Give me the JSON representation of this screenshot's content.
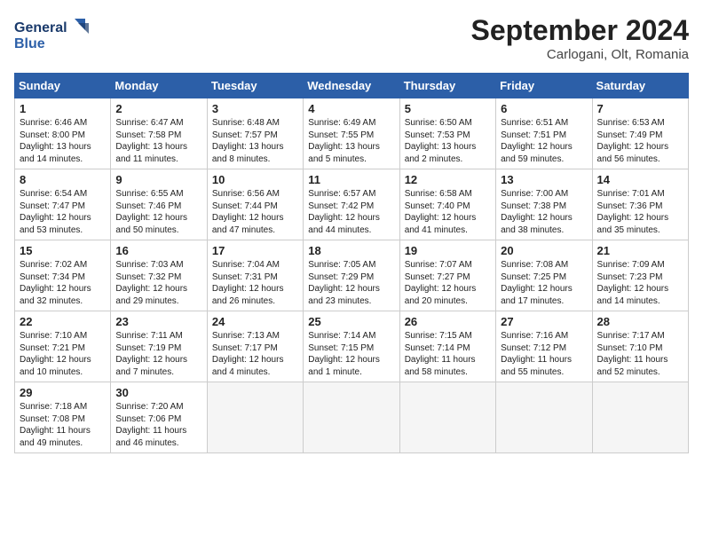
{
  "header": {
    "logo_line1": "General",
    "logo_line2": "Blue",
    "month": "September 2024",
    "location": "Carlogani, Olt, Romania"
  },
  "days_of_week": [
    "Sunday",
    "Monday",
    "Tuesday",
    "Wednesday",
    "Thursday",
    "Friday",
    "Saturday"
  ],
  "weeks": [
    [
      {
        "day": "1",
        "sunrise": "Sunrise: 6:46 AM",
        "sunset": "Sunset: 8:00 PM",
        "daylight": "Daylight: 13 hours and 14 minutes."
      },
      {
        "day": "2",
        "sunrise": "Sunrise: 6:47 AM",
        "sunset": "Sunset: 7:58 PM",
        "daylight": "Daylight: 13 hours and 11 minutes."
      },
      {
        "day": "3",
        "sunrise": "Sunrise: 6:48 AM",
        "sunset": "Sunset: 7:57 PM",
        "daylight": "Daylight: 13 hours and 8 minutes."
      },
      {
        "day": "4",
        "sunrise": "Sunrise: 6:49 AM",
        "sunset": "Sunset: 7:55 PM",
        "daylight": "Daylight: 13 hours and 5 minutes."
      },
      {
        "day": "5",
        "sunrise": "Sunrise: 6:50 AM",
        "sunset": "Sunset: 7:53 PM",
        "daylight": "Daylight: 13 hours and 2 minutes."
      },
      {
        "day": "6",
        "sunrise": "Sunrise: 6:51 AM",
        "sunset": "Sunset: 7:51 PM",
        "daylight": "Daylight: 12 hours and 59 minutes."
      },
      {
        "day": "7",
        "sunrise": "Sunrise: 6:53 AM",
        "sunset": "Sunset: 7:49 PM",
        "daylight": "Daylight: 12 hours and 56 minutes."
      }
    ],
    [
      {
        "day": "8",
        "sunrise": "Sunrise: 6:54 AM",
        "sunset": "Sunset: 7:47 PM",
        "daylight": "Daylight: 12 hours and 53 minutes."
      },
      {
        "day": "9",
        "sunrise": "Sunrise: 6:55 AM",
        "sunset": "Sunset: 7:46 PM",
        "daylight": "Daylight: 12 hours and 50 minutes."
      },
      {
        "day": "10",
        "sunrise": "Sunrise: 6:56 AM",
        "sunset": "Sunset: 7:44 PM",
        "daylight": "Daylight: 12 hours and 47 minutes."
      },
      {
        "day": "11",
        "sunrise": "Sunrise: 6:57 AM",
        "sunset": "Sunset: 7:42 PM",
        "daylight": "Daylight: 12 hours and 44 minutes."
      },
      {
        "day": "12",
        "sunrise": "Sunrise: 6:58 AM",
        "sunset": "Sunset: 7:40 PM",
        "daylight": "Daylight: 12 hours and 41 minutes."
      },
      {
        "day": "13",
        "sunrise": "Sunrise: 7:00 AM",
        "sunset": "Sunset: 7:38 PM",
        "daylight": "Daylight: 12 hours and 38 minutes."
      },
      {
        "day": "14",
        "sunrise": "Sunrise: 7:01 AM",
        "sunset": "Sunset: 7:36 PM",
        "daylight": "Daylight: 12 hours and 35 minutes."
      }
    ],
    [
      {
        "day": "15",
        "sunrise": "Sunrise: 7:02 AM",
        "sunset": "Sunset: 7:34 PM",
        "daylight": "Daylight: 12 hours and 32 minutes."
      },
      {
        "day": "16",
        "sunrise": "Sunrise: 7:03 AM",
        "sunset": "Sunset: 7:32 PM",
        "daylight": "Daylight: 12 hours and 29 minutes."
      },
      {
        "day": "17",
        "sunrise": "Sunrise: 7:04 AM",
        "sunset": "Sunset: 7:31 PM",
        "daylight": "Daylight: 12 hours and 26 minutes."
      },
      {
        "day": "18",
        "sunrise": "Sunrise: 7:05 AM",
        "sunset": "Sunset: 7:29 PM",
        "daylight": "Daylight: 12 hours and 23 minutes."
      },
      {
        "day": "19",
        "sunrise": "Sunrise: 7:07 AM",
        "sunset": "Sunset: 7:27 PM",
        "daylight": "Daylight: 12 hours and 20 minutes."
      },
      {
        "day": "20",
        "sunrise": "Sunrise: 7:08 AM",
        "sunset": "Sunset: 7:25 PM",
        "daylight": "Daylight: 12 hours and 17 minutes."
      },
      {
        "day": "21",
        "sunrise": "Sunrise: 7:09 AM",
        "sunset": "Sunset: 7:23 PM",
        "daylight": "Daylight: 12 hours and 14 minutes."
      }
    ],
    [
      {
        "day": "22",
        "sunrise": "Sunrise: 7:10 AM",
        "sunset": "Sunset: 7:21 PM",
        "daylight": "Daylight: 12 hours and 10 minutes."
      },
      {
        "day": "23",
        "sunrise": "Sunrise: 7:11 AM",
        "sunset": "Sunset: 7:19 PM",
        "daylight": "Daylight: 12 hours and 7 minutes."
      },
      {
        "day": "24",
        "sunrise": "Sunrise: 7:13 AM",
        "sunset": "Sunset: 7:17 PM",
        "daylight": "Daylight: 12 hours and 4 minutes."
      },
      {
        "day": "25",
        "sunrise": "Sunrise: 7:14 AM",
        "sunset": "Sunset: 7:15 PM",
        "daylight": "Daylight: 12 hours and 1 minute."
      },
      {
        "day": "26",
        "sunrise": "Sunrise: 7:15 AM",
        "sunset": "Sunset: 7:14 PM",
        "daylight": "Daylight: 11 hours and 58 minutes."
      },
      {
        "day": "27",
        "sunrise": "Sunrise: 7:16 AM",
        "sunset": "Sunset: 7:12 PM",
        "daylight": "Daylight: 11 hours and 55 minutes."
      },
      {
        "day": "28",
        "sunrise": "Sunrise: 7:17 AM",
        "sunset": "Sunset: 7:10 PM",
        "daylight": "Daylight: 11 hours and 52 minutes."
      }
    ],
    [
      {
        "day": "29",
        "sunrise": "Sunrise: 7:18 AM",
        "sunset": "Sunset: 7:08 PM",
        "daylight": "Daylight: 11 hours and 49 minutes."
      },
      {
        "day": "30",
        "sunrise": "Sunrise: 7:20 AM",
        "sunset": "Sunset: 7:06 PM",
        "daylight": "Daylight: 11 hours and 46 minutes."
      },
      null,
      null,
      null,
      null,
      null
    ]
  ]
}
